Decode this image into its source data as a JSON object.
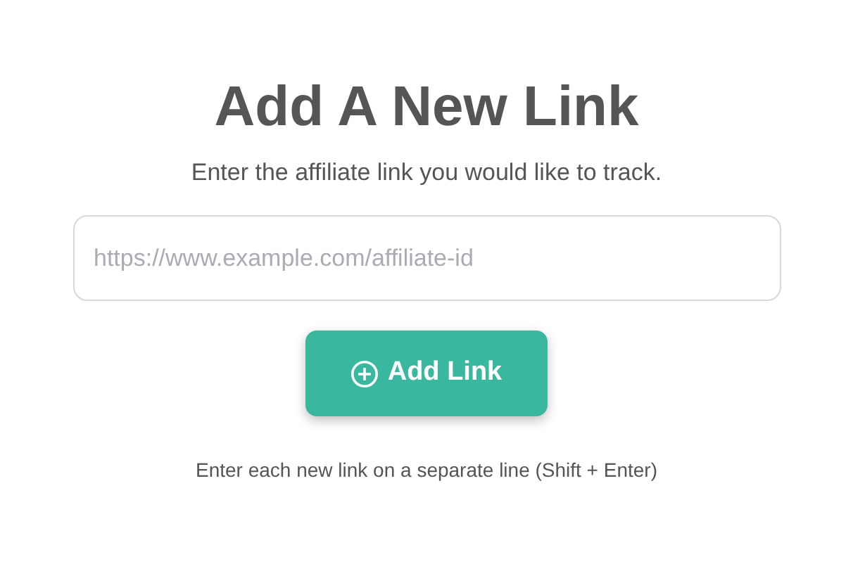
{
  "title": "Add A New Link",
  "subtitle": "Enter the affiliate link you would like to track.",
  "link_field": {
    "placeholder": "https://www.example.com/affiliate-id"
  },
  "add_button": {
    "label": "Add Link"
  },
  "hint": "Enter each new link on a separate line (Shift + Enter)"
}
